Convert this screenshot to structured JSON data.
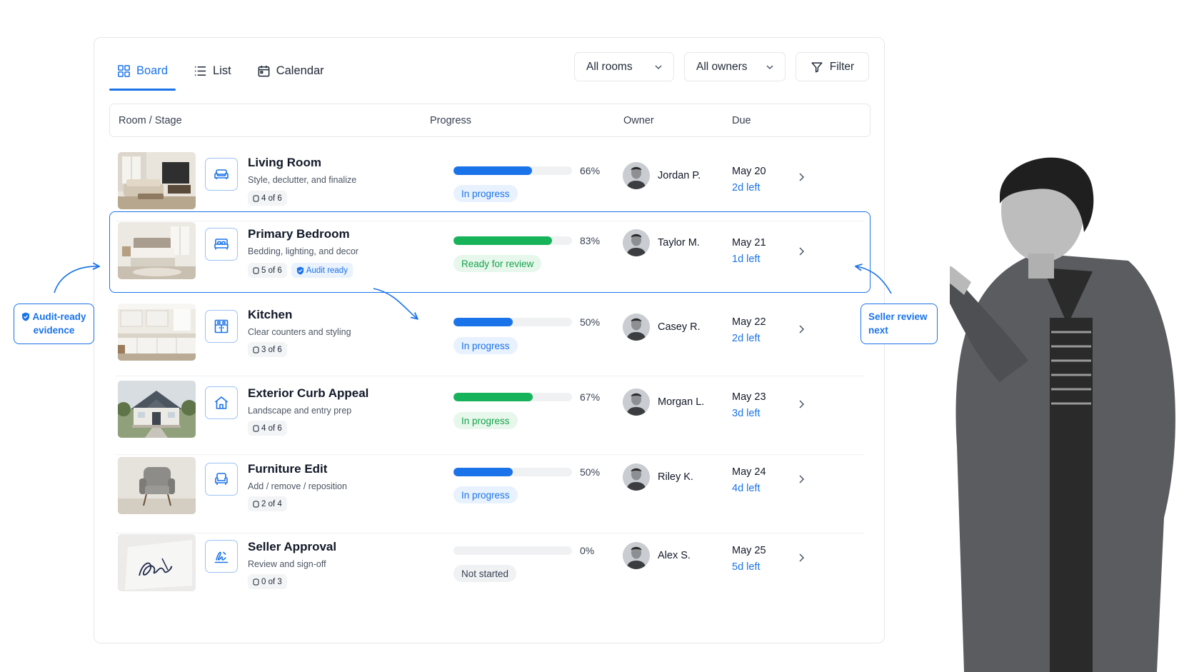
{
  "views": [
    {
      "label": "Board",
      "icon": "grid-icon",
      "active": true
    },
    {
      "label": "List",
      "icon": "list-icon",
      "active": false
    },
    {
      "label": "Calendar",
      "icon": "calendar-icon",
      "active": false
    }
  ],
  "filters": {
    "rooms": "All rooms",
    "owners": "All owners",
    "filter_label": "Filter"
  },
  "columns": {
    "room_stage": "Room / Stage",
    "progress": "Progress",
    "owner": "Owner",
    "due": "Due"
  },
  "rows": [
    {
      "title": "Living Room",
      "subtitle": "Style, declutter, and finalize",
      "count": "4 of 6",
      "progress": 66,
      "pct": "66%",
      "bar_color": "#1a73e8",
      "status": "In progress",
      "owner": "Jordan P.",
      "due": "May 20",
      "left": "2d left"
    },
    {
      "title": "Primary Bedroom",
      "subtitle": "Bedding, lighting, and decor",
      "count": "5 of 6",
      "audit": "Audit ready",
      "progress": 83,
      "pct": "83%",
      "bar_color": "#16b35a",
      "status": "Ready for review",
      "owner": "Taylor M.",
      "due": "May 21",
      "left": "1d left"
    },
    {
      "title": "Kitchen",
      "subtitle": "Clear counters and styling",
      "count": "3 of 6",
      "progress": 50,
      "pct": "50%",
      "bar_color": "#1a73e8",
      "status": "In progress",
      "owner": "Casey R.",
      "due": "May 22",
      "left": "2d left"
    },
    {
      "title": "Exterior Curb Appeal",
      "subtitle": "Landscape and entry prep",
      "count": "4 of 6",
      "progress": 67,
      "pct": "67%",
      "bar_color": "#16b35a",
      "status": "In progress",
      "owner": "Morgan L.",
      "due": "May 23",
      "left": "3d left"
    },
    {
      "title": "Furniture Edit",
      "subtitle": "Add / remove / reposition",
      "count": "2 of 4",
      "progress": 50,
      "pct": "50%",
      "bar_color": "#1a73e8",
      "status": "In progress",
      "owner": "Riley K.",
      "due": "May 24",
      "left": "4d left"
    },
    {
      "title": "Seller Approval",
      "subtitle": "Review and sign-off",
      "count": "0 of 3",
      "progress": 0,
      "pct": "0%",
      "bar_color": "#1a73e8",
      "status": "Not started",
      "owner": "Alex S.",
      "due": "May 25",
      "left": "5d left"
    }
  ],
  "callouts": {
    "audit_line1": "Audit-ready",
    "audit_line2": "evidence",
    "seller_line1": "Seller review",
    "seller_line2": "next"
  }
}
